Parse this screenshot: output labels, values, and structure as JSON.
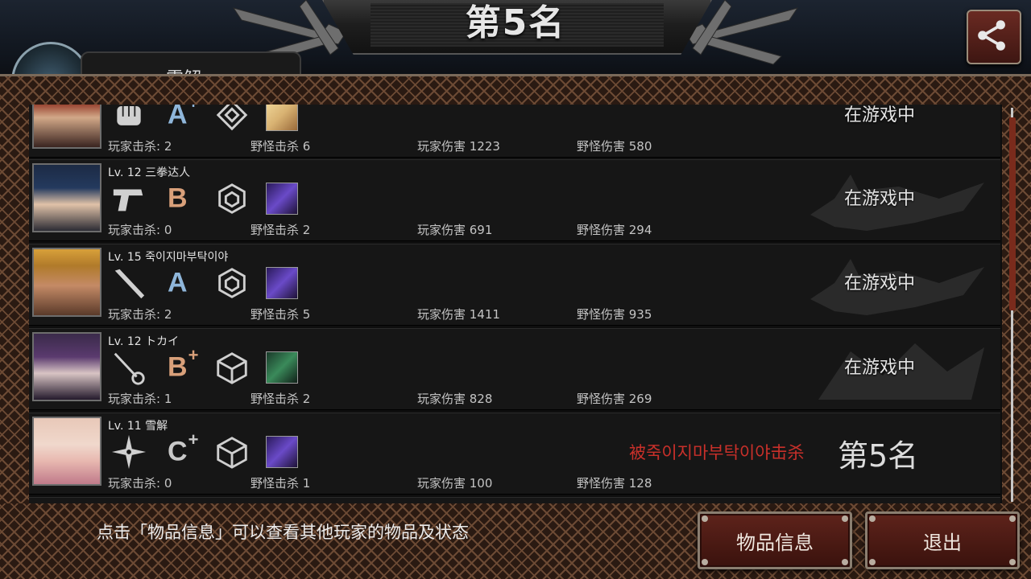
{
  "header": {
    "title": "第5名",
    "current_player_name": "雪解"
  },
  "players": [
    {
      "level_name": "",
      "weapon_icon": "fist-icon",
      "grade": "A",
      "grade_plus": "+",
      "grade_color": "#8fb6da",
      "armor_icon": "diamond-emblem-icon",
      "item_icon": "blonde-character-item-icon",
      "player_kills": "玩家击杀: 2",
      "monster_kills": "野怪击杀 6",
      "player_damage": "玩家伤害 1223",
      "monster_damage": "野怪伤害 580",
      "status": "在游戏中",
      "killed_by": "",
      "rank": ""
    },
    {
      "level_name": "Lv. 12 三拳达人",
      "weapon_icon": "pistol-icon",
      "grade": "B",
      "grade_plus": "",
      "grade_color": "#d9a07a",
      "armor_icon": "hexagon-emblem-icon",
      "item_icon": "purple-skill-item-icon",
      "player_kills": "玩家击杀: 0",
      "monster_kills": "野怪击杀 2",
      "player_damage": "玩家伤害 691",
      "monster_damage": "野怪伤害 294",
      "status": "在游戏中",
      "killed_by": "",
      "rank": ""
    },
    {
      "level_name": "Lv. 15 죽이지마부탁이야",
      "weapon_icon": "bat-icon",
      "grade": "A",
      "grade_plus": "",
      "grade_color": "#8fb6da",
      "armor_icon": "hexagon-emblem-icon",
      "item_icon": "purple-skill-item-icon",
      "player_kills": "玩家击杀: 2",
      "monster_kills": "野怪击杀 5",
      "player_damage": "玩家伤害 1411",
      "monster_damage": "野怪伤害 935",
      "status": "在游戏中",
      "killed_by": "",
      "rank": ""
    },
    {
      "level_name": "Lv. 12 トカイ",
      "weapon_icon": "rapier-icon",
      "grade": "B",
      "grade_plus": "+",
      "grade_color": "#d9a07a",
      "armor_icon": "cube-emblem-icon",
      "item_icon": "green-skill-item-icon",
      "player_kills": "玩家击杀: 1",
      "monster_kills": "野怪击杀 2",
      "player_damage": "玩家伤害 828",
      "monster_damage": "野怪伤害 269",
      "status": "在游戏中",
      "killed_by": "",
      "rank": ""
    },
    {
      "level_name": "Lv. 11 雪解",
      "weapon_icon": "shuriken-icon",
      "grade": "C",
      "grade_plus": "+",
      "grade_color": "#c8c8c8",
      "armor_icon": "cube-emblem-icon",
      "item_icon": "purple-skill-item-icon",
      "player_kills": "玩家击杀: 0",
      "monster_kills": "野怪击杀 1",
      "player_damage": "玩家伤害 100",
      "monster_damage": "野怪伤害 128",
      "status": "",
      "killed_by": "被죽이지마부탁이야击杀",
      "rank": "第5名"
    }
  ],
  "footer": {
    "hint": "点击「物品信息」可以查看其他玩家的物品及状态",
    "items_button": "物品信息",
    "exit_button": "退出"
  }
}
